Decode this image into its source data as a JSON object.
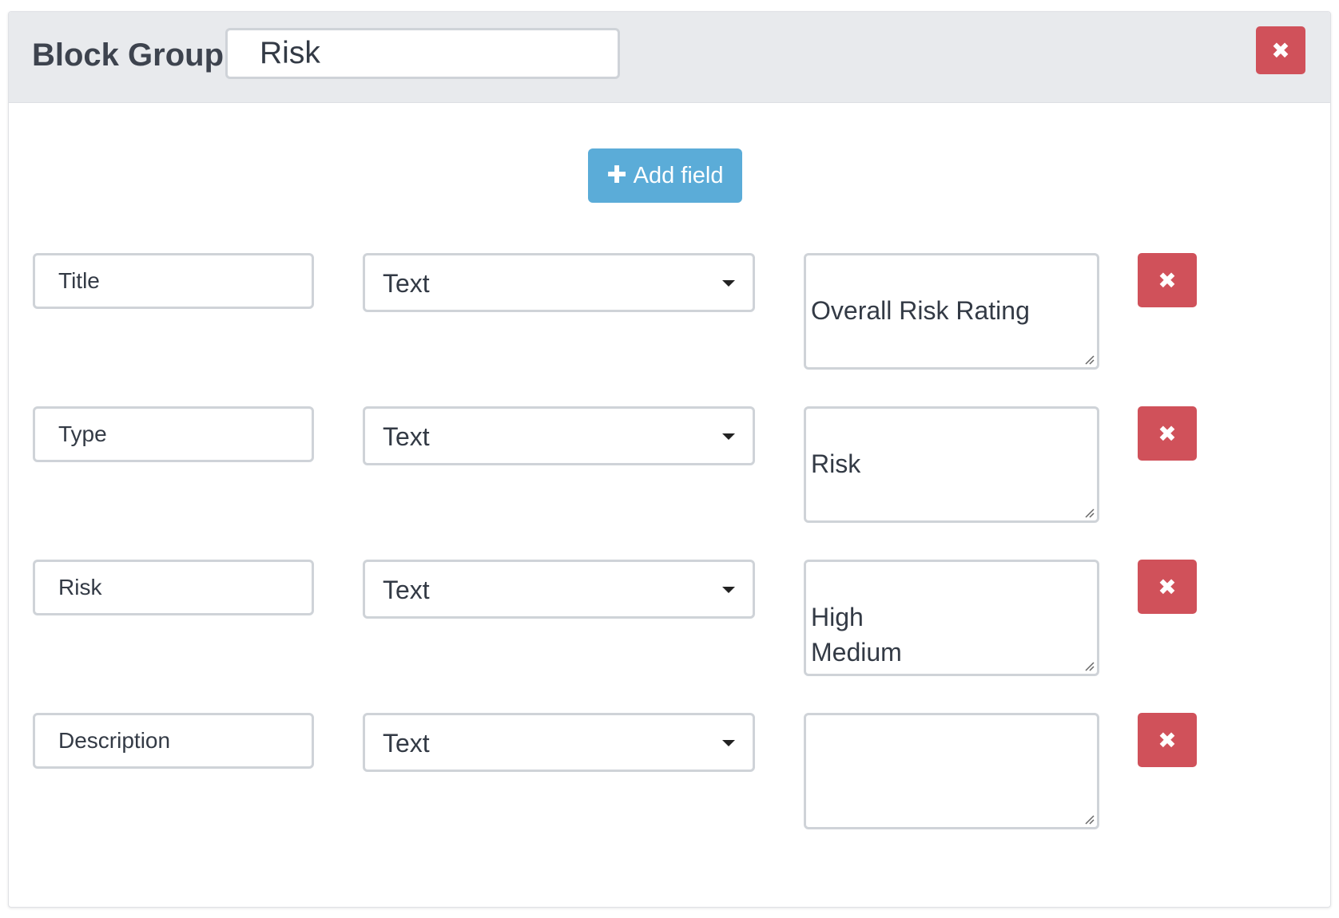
{
  "header": {
    "title": "Block Group",
    "group_name_value": "Risk",
    "close_icon": "close-icon"
  },
  "toolbar": {
    "add_field_icon": "plus-icon",
    "add_field_label": "Add field"
  },
  "fields": [
    {
      "name": "Title",
      "type": "Text",
      "options": "Overall Risk Rating"
    },
    {
      "name": "Type",
      "type": "Text",
      "options": "Risk"
    },
    {
      "name": "Risk",
      "type": "Text",
      "options": "High\nMedium\nLow"
    },
    {
      "name": "Description",
      "type": "Text",
      "options": ""
    }
  ],
  "colors": {
    "header_bg": "#e8eaed",
    "danger": "#d0515a",
    "primary": "#5bacd8",
    "border": "#cfd3d8"
  }
}
